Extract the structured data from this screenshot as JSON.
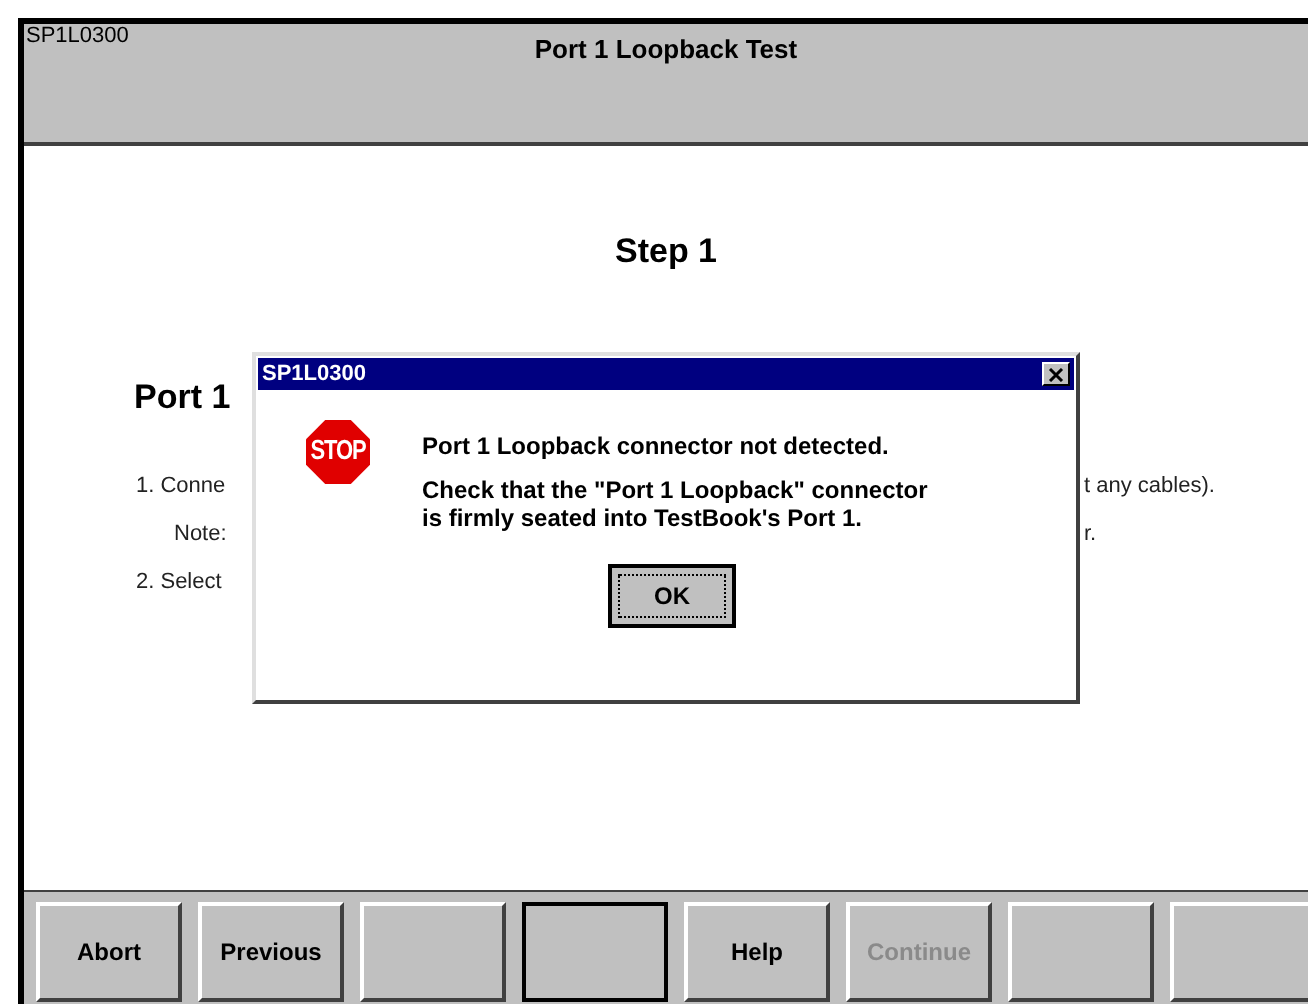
{
  "header": {
    "code": "SP1L0300",
    "title": "Port 1 Loopback Test"
  },
  "body": {
    "step": "Step 1",
    "heading": "Port 1",
    "lines": [
      {
        "left": "1. Conne",
        "right": "t any cables).",
        "indent": false
      },
      {
        "left": "Note:",
        "right": "r.",
        "indent": true
      },
      {
        "left": "2. Select",
        "indent": false
      }
    ]
  },
  "dialog": {
    "title": "SP1L0300",
    "message": "Port 1 Loopback connector not detected.",
    "detail": "Check that the \"Port 1 Loopback\" connector is firmly seated into TestBook's Port 1.",
    "icon_text": "STOP",
    "button": "OK"
  },
  "buttons": [
    {
      "label": "Abort",
      "disabled": false,
      "default": false
    },
    {
      "label": "Previous",
      "disabled": false,
      "default": false
    },
    {
      "default": false
    },
    {
      "default": true
    },
    {
      "label": "Help",
      "disabled": false,
      "default": false
    },
    {
      "label": "Continue",
      "disabled": true,
      "default": false
    },
    {
      "default": false
    },
    {
      "default": false
    }
  ]
}
